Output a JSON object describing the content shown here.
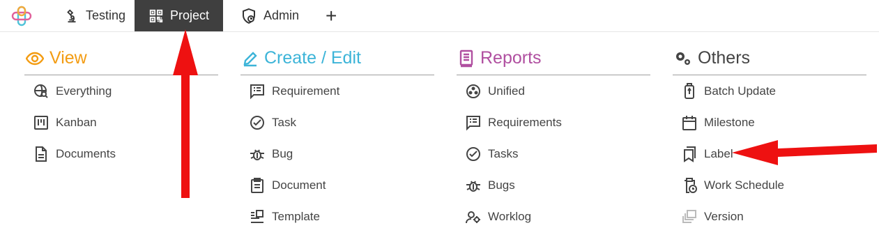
{
  "tabs": [
    {
      "label": "Testing",
      "icon": "microscope-icon"
    },
    {
      "label": "Project",
      "icon": "qr-code-icon",
      "active": true
    },
    {
      "label": "Admin",
      "icon": "shield-user-icon"
    },
    {
      "label": "+",
      "icon": "plus-icon"
    }
  ],
  "columns": [
    {
      "title": "View",
      "color": "#f39c12",
      "icon": "eye-icon",
      "items": [
        {
          "label": "Everything",
          "icon": "globe-search-icon"
        },
        {
          "label": "Kanban",
          "icon": "kanban-icon"
        },
        {
          "label": "Documents",
          "icon": "document-icon"
        }
      ]
    },
    {
      "title": "Create / Edit",
      "color": "#3cb4d8",
      "icon": "pencil-icon",
      "items": [
        {
          "label": "Requirement",
          "icon": "list-box-icon"
        },
        {
          "label": "Task",
          "icon": "check-circle-icon"
        },
        {
          "label": "Bug",
          "icon": "bug-icon"
        },
        {
          "label": "Document",
          "icon": "clipboard-icon"
        },
        {
          "label": "Template",
          "icon": "template-icon"
        }
      ]
    },
    {
      "title": "Reports",
      "color": "#b04fa0",
      "icon": "notebook-icon",
      "items": [
        {
          "label": "Unified",
          "icon": "circle-dots-icon"
        },
        {
          "label": "Requirements",
          "icon": "list-box-icon"
        },
        {
          "label": "Tasks",
          "icon": "check-circle-icon"
        },
        {
          "label": "Bugs",
          "icon": "bug-icon"
        },
        {
          "label": "Worklog",
          "icon": "user-gear-icon"
        }
      ]
    },
    {
      "title": "Others",
      "color": "#444444",
      "icon": "gears-icon",
      "items": [
        {
          "label": "Batch Update",
          "icon": "battery-icon"
        },
        {
          "label": "Milestone",
          "icon": "calendar-icon"
        },
        {
          "label": "Label",
          "icon": "bookmarks-icon"
        },
        {
          "label": "Work Schedule",
          "icon": "clipboard-clock-icon"
        },
        {
          "label": "Version",
          "icon": "stack-icon"
        }
      ]
    }
  ]
}
